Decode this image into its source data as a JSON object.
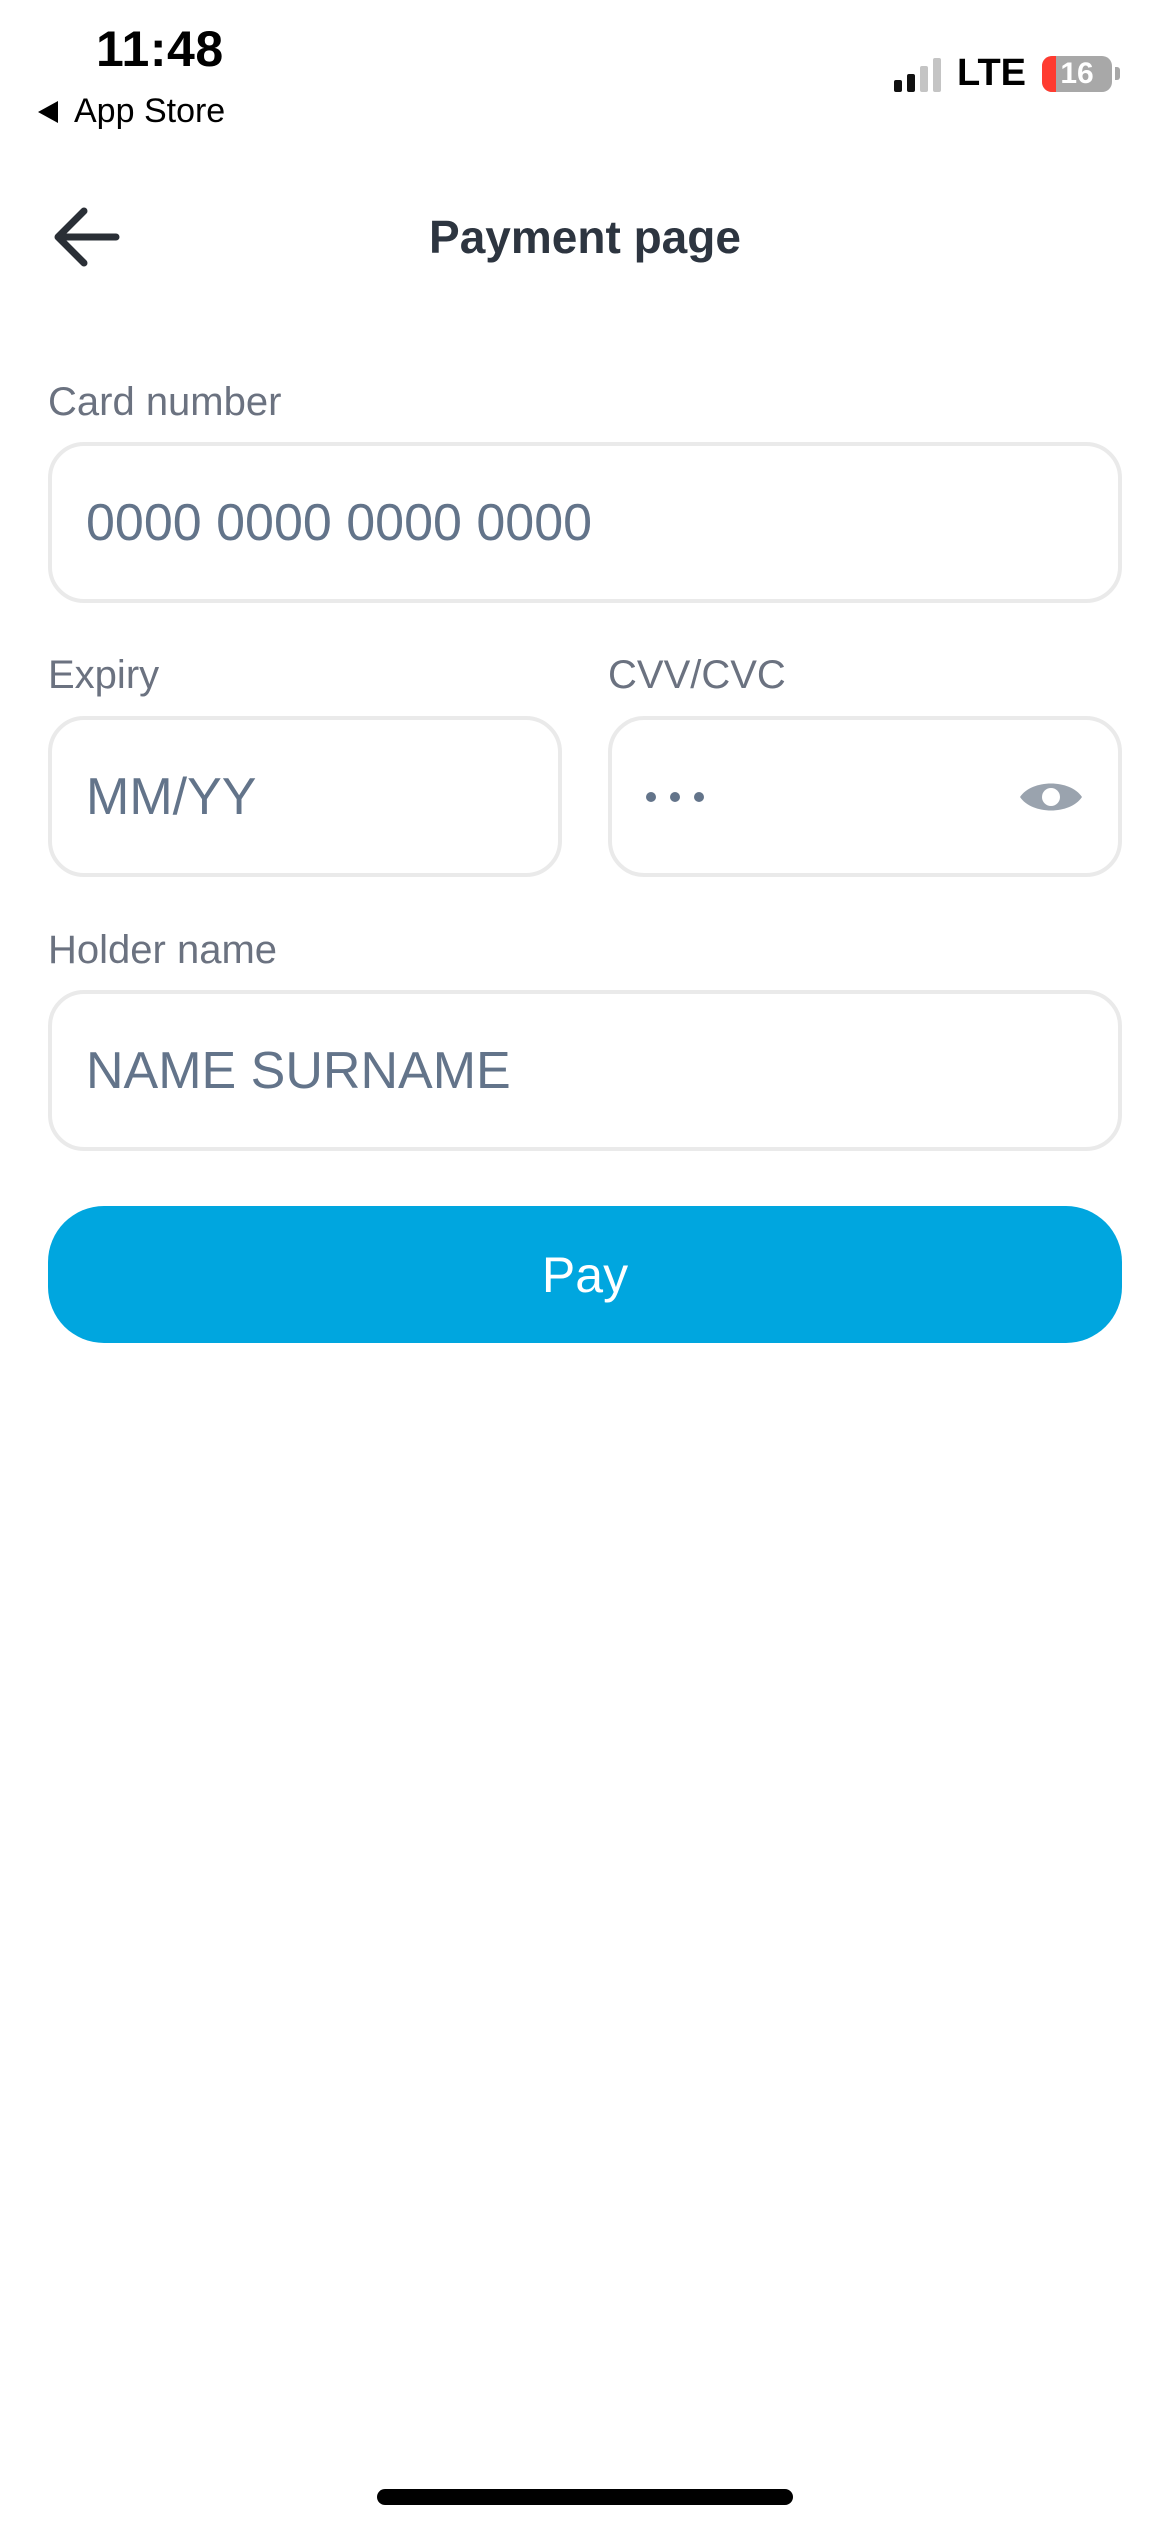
{
  "status_bar": {
    "time": "11:48",
    "back_app": "App Store",
    "network": "LTE",
    "battery": "16",
    "battery_level_percent": 16
  },
  "header": {
    "title": "Payment page",
    "back_icon": "arrow-left-icon"
  },
  "form": {
    "card_number": {
      "label": "Card number",
      "placeholder": "0000 0000 0000 0000",
      "value": ""
    },
    "expiry": {
      "label": "Expiry",
      "placeholder": "MM/YY",
      "value": ""
    },
    "cvv": {
      "label": "CVV/CVC",
      "masked": "•••",
      "toggle_icon": "eye-icon"
    },
    "holder_name": {
      "label": "Holder name",
      "placeholder": "NAME SURNAME",
      "value": ""
    }
  },
  "pay_button": {
    "label": "Pay",
    "color": "#00a6df"
  }
}
